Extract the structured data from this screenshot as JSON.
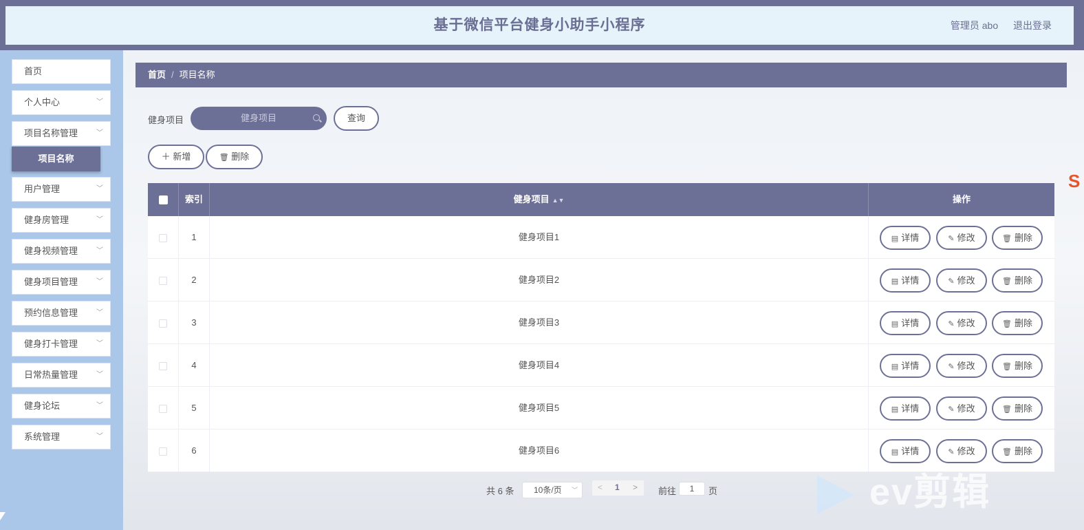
{
  "header": {
    "title": "基于微信平台健身小助手小程序",
    "user": "管理员 abo",
    "logout": "退出登录"
  },
  "sidebar": {
    "items": [
      {
        "label": "首页",
        "has_arrow": false
      },
      {
        "label": "个人中心",
        "has_arrow": true
      },
      {
        "label": "项目名称管理",
        "has_arrow": true
      },
      {
        "label": "用户管理",
        "has_arrow": true
      },
      {
        "label": "健身房管理",
        "has_arrow": true
      },
      {
        "label": "健身视频管理",
        "has_arrow": true
      },
      {
        "label": "健身项目管理",
        "has_arrow": true
      },
      {
        "label": "预约信息管理",
        "has_arrow": true
      },
      {
        "label": "健身打卡管理",
        "has_arrow": true
      },
      {
        "label": "日常热量管理",
        "has_arrow": true
      },
      {
        "label": "健身论坛",
        "has_arrow": true
      },
      {
        "label": "系统管理",
        "has_arrow": true
      }
    ],
    "active_sub": "项目名称"
  },
  "breadcrumb": {
    "home": "首页",
    "separator": "/",
    "current": "项目名称"
  },
  "search": {
    "label": "健身项目",
    "placeholder": "健身项目",
    "button": "查询"
  },
  "actions": {
    "add": "新增",
    "delete": "删除"
  },
  "table": {
    "headers": {
      "index": "索引",
      "name": "健身项目",
      "ops": "操作"
    },
    "rows": [
      {
        "index": "1",
        "name": "健身项目1"
      },
      {
        "index": "2",
        "name": "健身项目2"
      },
      {
        "index": "3",
        "name": "健身项目3"
      },
      {
        "index": "4",
        "name": "健身项目4"
      },
      {
        "index": "5",
        "name": "健身项目5"
      },
      {
        "index": "6",
        "name": "健身项目6"
      }
    ],
    "op_labels": {
      "detail": "详情",
      "edit": "修改",
      "delete": "删除"
    }
  },
  "pagination": {
    "total": "共 6 条",
    "page_size": "10条/页",
    "current_page": "1",
    "goto_label": "前往",
    "goto_value": "1",
    "page_suffix": "页"
  },
  "watermark": {
    "text": "ev剪辑"
  },
  "colors": {
    "accent": "#6d7096",
    "sidebar_bg": "#aac6e8",
    "header_bg": "#e6f3fb"
  }
}
